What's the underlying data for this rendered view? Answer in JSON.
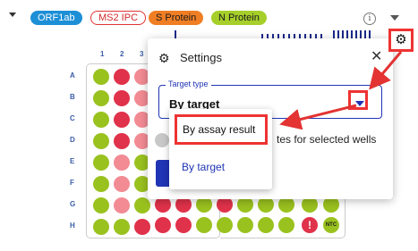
{
  "target_chips": [
    {
      "label": "ORF1ab"
    },
    {
      "label": "MS2 IPC"
    },
    {
      "label": "S Protein"
    },
    {
      "label": "N Protein"
    }
  ],
  "plate": {
    "column_labels": [
      "1",
      "2",
      "3"
    ],
    "row_labels": [
      "A",
      "B",
      "C",
      "D",
      "E",
      "F",
      "G",
      "H"
    ],
    "ntc_label": "NTC",
    "warning_symbol": "!"
  },
  "settings_popup": {
    "title": "Settings",
    "close_symbol": "✕",
    "target_type_legend": "Target type",
    "target_type_value": "By target",
    "description_text": "tes for selected wells"
  },
  "target_type_menu": {
    "options": [
      {
        "label": "By assay result"
      },
      {
        "label": "By target"
      }
    ]
  },
  "colors": {
    "accent": "#2035b5",
    "annotation_red": "#e33333",
    "orf1ab": "#1c8fd6",
    "s_protein": "#f07e24",
    "n_protein": "#a6cf2b"
  }
}
